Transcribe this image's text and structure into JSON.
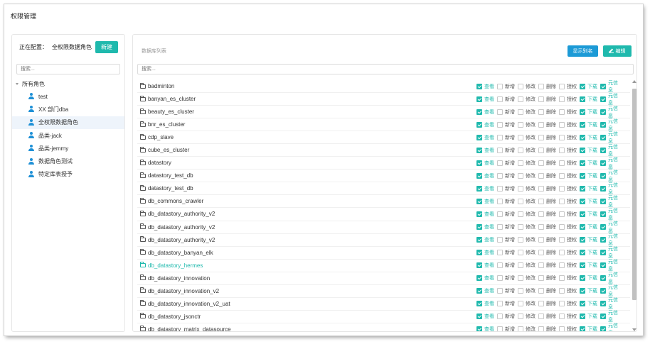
{
  "page": {
    "title": "权限管理"
  },
  "left_panel": {
    "config_label": "正在配置：",
    "config_value": "全权限数据角色",
    "new_button": "新建",
    "search_placeholder": "搜索...",
    "tree_root": "所有角色",
    "roles": [
      {
        "label": "test",
        "active": false
      },
      {
        "label": "XX 部门dba",
        "active": false
      },
      {
        "label": "全权限数据角色",
        "active": true
      },
      {
        "label": "品类-jack",
        "active": false
      },
      {
        "label": "品类-jemmy",
        "active": false
      },
      {
        "label": "数据角色测试",
        "active": false
      },
      {
        "label": "特定库表授予",
        "active": false
      }
    ]
  },
  "right_panel": {
    "list_title": "数据库列表",
    "alias_button": "显示别名",
    "edit_button": "编辑",
    "search_placeholder": "搜索...",
    "perm_labels": [
      "查看",
      "新增",
      "修改",
      "删除",
      "授权",
      "下载",
      "元信息"
    ],
    "databases": [
      {
        "name": "badminton",
        "highlight": false,
        "perms": [
          true,
          false,
          false,
          false,
          false,
          true,
          true
        ]
      },
      {
        "name": "banyan_es_cluster",
        "highlight": false,
        "perms": [
          true,
          false,
          false,
          false,
          false,
          true,
          true
        ]
      },
      {
        "name": "beauty_es_cluster",
        "highlight": false,
        "perms": [
          true,
          false,
          false,
          false,
          false,
          true,
          true
        ]
      },
      {
        "name": "bnr_es_cluster",
        "highlight": false,
        "perms": [
          true,
          false,
          false,
          false,
          false,
          true,
          true
        ]
      },
      {
        "name": "cdp_slave",
        "highlight": false,
        "perms": [
          true,
          false,
          false,
          false,
          false,
          true,
          true
        ]
      },
      {
        "name": "cube_es_cluster",
        "highlight": false,
        "perms": [
          true,
          false,
          false,
          false,
          false,
          true,
          true
        ]
      },
      {
        "name": "datastory",
        "highlight": false,
        "perms": [
          true,
          false,
          false,
          false,
          false,
          true,
          true
        ]
      },
      {
        "name": "datastory_test_db",
        "highlight": false,
        "perms": [
          true,
          false,
          false,
          false,
          false,
          true,
          true
        ]
      },
      {
        "name": "datastory_test_db",
        "highlight": false,
        "perms": [
          true,
          false,
          false,
          false,
          false,
          true,
          true
        ]
      },
      {
        "name": "db_commons_crawler",
        "highlight": false,
        "perms": [
          true,
          false,
          false,
          false,
          false,
          true,
          true
        ]
      },
      {
        "name": "db_datastory_authority_v2",
        "highlight": false,
        "perms": [
          true,
          false,
          false,
          false,
          false,
          true,
          true
        ]
      },
      {
        "name": "db_datastory_authority_v2",
        "highlight": false,
        "perms": [
          true,
          false,
          false,
          false,
          false,
          true,
          true
        ]
      },
      {
        "name": "db_datastory_authority_v2",
        "highlight": false,
        "perms": [
          true,
          false,
          false,
          false,
          false,
          true,
          true
        ]
      },
      {
        "name": "db_datastory_banyan_elk",
        "highlight": false,
        "perms": [
          true,
          false,
          false,
          false,
          false,
          true,
          true
        ]
      },
      {
        "name": "db_datastory_hermes",
        "highlight": true,
        "perms": [
          true,
          false,
          false,
          false,
          false,
          true,
          true
        ]
      },
      {
        "name": "db_datastory_innovation",
        "highlight": false,
        "perms": [
          true,
          false,
          false,
          false,
          false,
          true,
          true
        ]
      },
      {
        "name": "db_datastory_innovation_v2",
        "highlight": false,
        "perms": [
          true,
          false,
          false,
          false,
          false,
          true,
          true
        ]
      },
      {
        "name": "db_datastory_innovation_v2_uat",
        "highlight": false,
        "perms": [
          true,
          false,
          false,
          false,
          false,
          true,
          true
        ]
      },
      {
        "name": "db_datastory_jsonctr",
        "highlight": false,
        "perms": [
          true,
          false,
          false,
          false,
          false,
          true,
          true
        ]
      },
      {
        "name": "db_datastory_matrix_datasource",
        "highlight": false,
        "perms": [
          true,
          false,
          false,
          false,
          false,
          true,
          true
        ]
      }
    ]
  },
  "colors": {
    "accent": "#1fb9ad",
    "blue": "#1c9ad6"
  }
}
